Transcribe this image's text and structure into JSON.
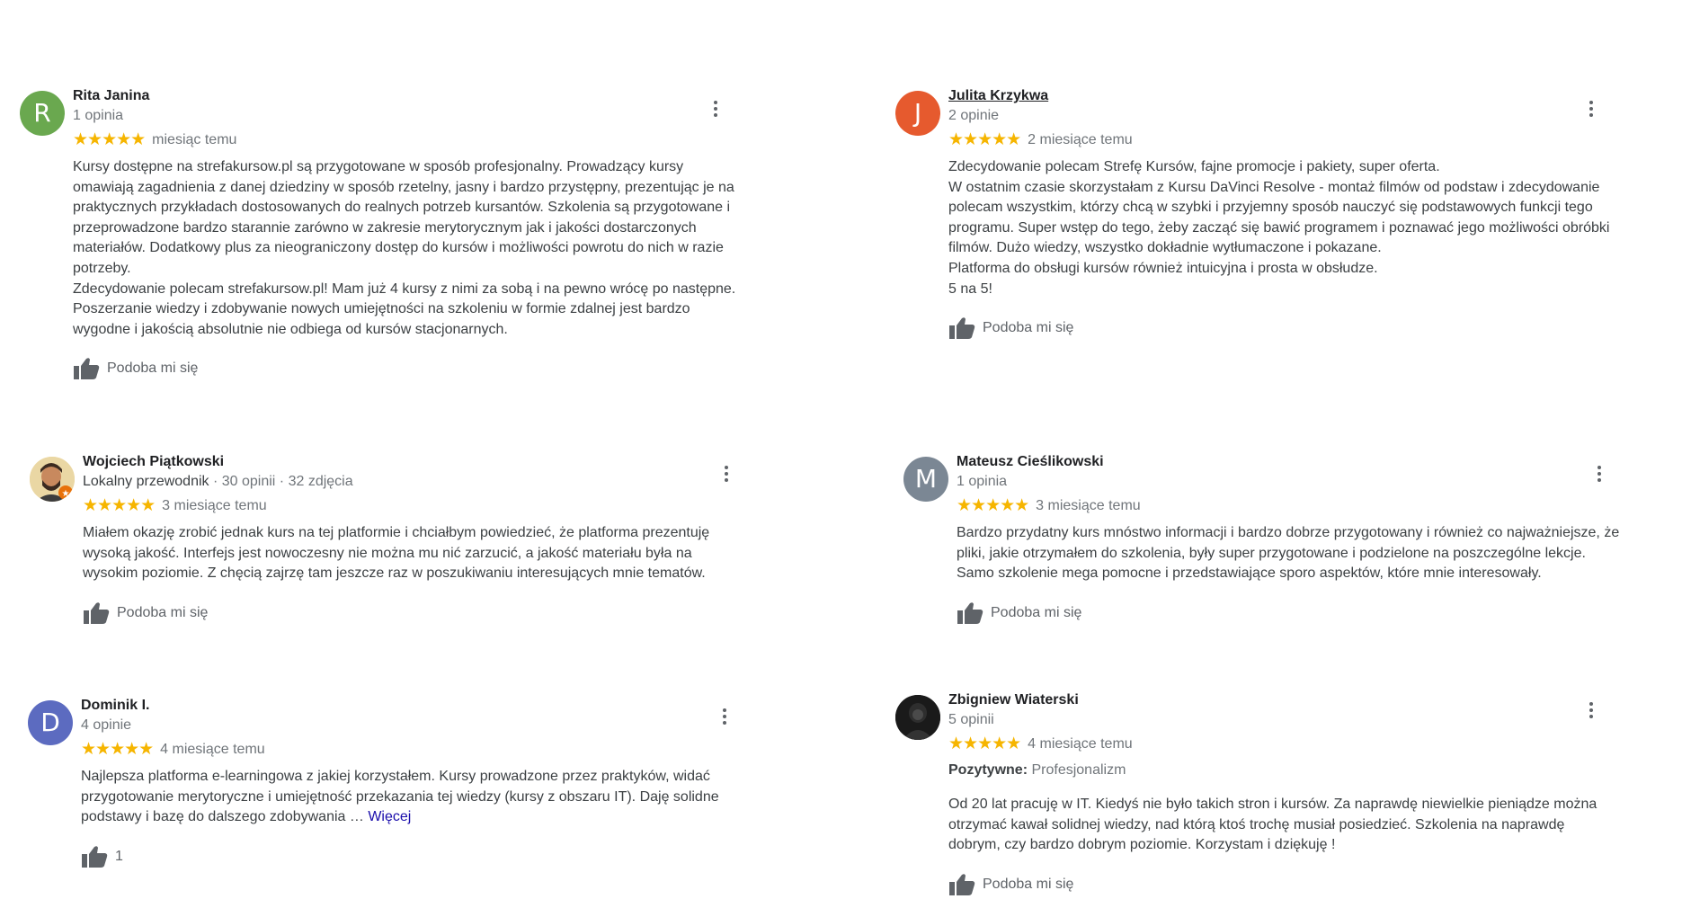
{
  "like_label": "Podoba mi się",
  "stars": "★★★★★",
  "colors": {
    "star": "#f6b500",
    "link": "#1a0dab",
    "accent_orange": "#e65a2e",
    "green": "#6aa84f",
    "slate": "#7b8794",
    "indigo": "#5c6bc0"
  },
  "reviews": [
    {
      "avatar_letter": "R",
      "author": "Rita Janina",
      "meta": "1 opinia",
      "date": "miesiąc temu",
      "body": "Kursy dostępne na strefakursow.pl są przygotowane w sposób profesjonalny. Prowadzący kursy\nomawiają zagadnienia z danej dziedziny w sposób rzetelny, jasny  i bardzo przystępny, prezentując je na\npraktycznych przykładach dostosowanych do realnych potrzeb kursantów. Szkolenia są przygotowane i\nprzeprowadzone bardzo starannie zarówno w zakresie merytorycznym jak i jakości dostarczonych\nmateriałów. Dodatkowy plus za nieograniczony dostęp do kursów i możliwości powrotu do nich w razie\npotrzeby.\nZdecydowanie polecam strefakursow.pl! Mam już 4 kursy z nimi za sobą i na pewno wrócę po następne.\nPoszerzanie wiedzy i zdobywanie nowych umiejętności na szkoleniu w formie zdalnej jest bardzo\nwygodne i jakością absolutnie nie odbiega od kursów stacjonarnych."
    },
    {
      "avatar_letter": "J",
      "author": "Julita Krzykwa",
      "meta": "2 opinie",
      "date": "2 miesiące temu",
      "body": "Zdecydowanie polecam Strefę Kursów, fajne promocje i pakiety, super oferta.\nW ostatnim czasie skorzystałam z Kursu DaVinci Resolve - montaż filmów od podstaw i zdecydowanie\npolecam wszystkim, którzy chcą w szybki i przyjemny sposób nauczyć się podstawowych funkcji tego\nprogramu. Super wstęp do tego, żeby zacząć się bawić programem i poznawać jego możliwości obróbki\nfilmów. Dużo wiedzy, wszystko dokładnie wytłumaczone i pokazane.\nPlatforma do obsługi kursów również intuicyjna i prosta w obsłudze.\n5 na 5!"
    },
    {
      "author": "Wojciech Piątkowski",
      "meta_guide": "Lokalny przewodnik",
      "meta": " · 30 opinii · 32 zdjęcia",
      "date": "3 miesiące temu",
      "body": "Miałem okazję zrobić jednak kurs na tej platformie i chciałbym powiedzieć, że platforma prezentuję\nwysoką jakość. Interfejs jest nowoczesny nie można mu nić zarzucić, a jakość materiału była na\nwysokim poziomie. Z chęcią zajrzę tam jeszcze raz w poszukiwaniu interesujących mnie tematów."
    },
    {
      "avatar_letter": "M",
      "author": "Mateusz Cieślikowski",
      "meta": "1 opinia",
      "date": "3 miesiące temu",
      "body": "Bardzo przydatny kurs mnóstwo informacji i bardzo dobrze przygotowany i również co najważniejsze, że\npliki, jakie otrzymałem do szkolenia, były super przygotowane i podzielone na poszczególne lekcje.\nSamo szkolenie mega pomocne i przedstawiające sporo aspektów, które mnie interesowały."
    },
    {
      "avatar_letter": "D",
      "author": "Dominik I.",
      "meta": "4 opinie",
      "date": "4 miesiące temu",
      "body": "Najlepsza platforma e-learningowa z jakiej korzystałem. Kursy prowadzone przez praktyków, widać\nprzygotowanie merytoryczne i umiejętność przekazania tej wiedzy (kursy z obszaru IT). Daję solidne\npodstawy i bazę do dalszego zdobywania … ",
      "more": "Więcej",
      "like_count": "1"
    },
    {
      "author": "Zbigniew Wiaterski",
      "meta": "5 opinii",
      "date": "4 miesiące temu",
      "highlight_label": "Pozytywne:",
      "highlight_value": "Profesjonalizm",
      "body": "Od 20 lat pracuję w IT. Kiedyś nie było takich stron i kursów. Za naprawdę  niewielkie pieniądze można\notrzymać kawał solidnej wiedzy, nad którą ktoś trochę musiał posiedzieć. Szkolenia na naprawdę\ndobrym, czy bardzo dobrym poziomie. Korzystam i dziękuję !"
    }
  ]
}
